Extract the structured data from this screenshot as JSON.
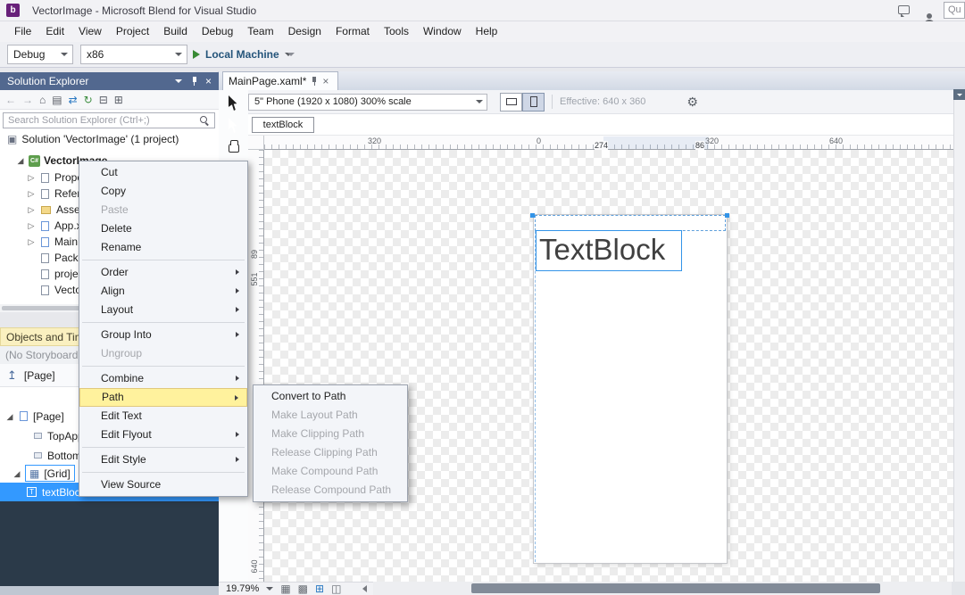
{
  "colors": {
    "accent": "#3399FF",
    "menu_highlight": "#FFF29D",
    "blend_purple": "#68217A",
    "run_green": "#388A34",
    "panel_header": "#52688F"
  },
  "titlebar": {
    "title": "VectorImage - Microsoft Blend for Visual Studio",
    "quick_launch": "Qu",
    "logo_letter": "b"
  },
  "menubar": {
    "items": [
      {
        "label": "File"
      },
      {
        "label": "Edit"
      },
      {
        "label": "View"
      },
      {
        "label": "Project"
      },
      {
        "label": "Build"
      },
      {
        "label": "Debug"
      },
      {
        "label": "Team"
      },
      {
        "label": "Design"
      },
      {
        "label": "Format"
      },
      {
        "label": "Tools"
      },
      {
        "label": "Window"
      },
      {
        "label": "Help"
      }
    ]
  },
  "toolbar": {
    "config": "Debug",
    "platform": "x86",
    "run_target": "Local Machine"
  },
  "icons": {
    "back": "←",
    "forward": "→",
    "home": "⌂",
    "scope": "▤",
    "sync": "⇄",
    "refresh": "↻",
    "collapse_all": "⊟",
    "show_all": "⊞",
    "expanded": "◢",
    "collapsed": "▷",
    "close": "×",
    "scope_up": "↥",
    "solution": "▣",
    "csharp": "C#",
    "grid_glyph": "▦",
    "textblock_t": "T",
    "zoom_grid": "▦",
    "snap_grid": "▩",
    "snap_lines": "⊞",
    "annotations": "◫",
    "gear": "⚙"
  },
  "solution_explorer": {
    "title": "Solution Explorer",
    "search_placeholder": "Search Solution Explorer (Ctrl+;)",
    "solution": "Solution 'VectorImage' (1 project)",
    "project": "VectorImage",
    "files": [
      {
        "label": "Properties"
      },
      {
        "label": "References"
      },
      {
        "label": "Assets"
      },
      {
        "label": "App.xaml"
      },
      {
        "label": "MainPage.xaml"
      },
      {
        "label": "Package.appxmanifest"
      },
      {
        "label": "project.json"
      },
      {
        "label": "VectorImage_TemporaryKey.pfx"
      }
    ]
  },
  "objects_panel": {
    "title": "Objects and Timeline",
    "storyboard_status": "(No Storyboard open)",
    "scope": "[Page]",
    "tree": [
      {
        "label": "[Page]"
      },
      {
        "label": "TopAppBar"
      },
      {
        "label": "BottomAppBar"
      },
      {
        "label": "[Grid]"
      },
      {
        "label": "textBlock"
      }
    ]
  },
  "context_menu": {
    "items": [
      {
        "label": "Cut"
      },
      {
        "label": "Copy"
      },
      {
        "label": "Paste",
        "disabled": true
      },
      {
        "label": "Delete"
      },
      {
        "label": "Rename"
      },
      {
        "label": "Order",
        "submenu": true
      },
      {
        "label": "Align",
        "submenu": true
      },
      {
        "label": "Layout",
        "submenu": true
      },
      {
        "label": "Group Into",
        "submenu": true
      },
      {
        "label": "Ungroup",
        "disabled": true
      },
      {
        "label": "Combine",
        "submenu": true
      },
      {
        "label": "Path",
        "submenu": true,
        "highlighted": true
      },
      {
        "label": "Edit Text"
      },
      {
        "label": "Edit Flyout",
        "submenu": true
      },
      {
        "label": "Edit Style",
        "submenu": true
      },
      {
        "label": "View Source"
      }
    ],
    "path_submenu": [
      {
        "label": "Convert to Path"
      },
      {
        "label": "Make Layout Path",
        "disabled": true
      },
      {
        "label": "Make Clipping Path",
        "disabled": true
      },
      {
        "label": "Release Clipping Path",
        "disabled": true
      },
      {
        "label": "Make Compound Path",
        "disabled": true
      },
      {
        "label": "Release Compound Path",
        "disabled": true
      }
    ]
  },
  "design_surface": {
    "tab": "MainPage.xaml*",
    "device": "5\" Phone (1920 x 1080) 300% scale",
    "effective": "Effective: 640 x 360",
    "breadcrumb": "textBlock",
    "zoom": "19.79%",
    "artboard_text": "TextBlock",
    "ruler_h": [
      "320",
      "0",
      "320",
      "640"
    ],
    "ruler_markers": [
      "274",
      "86"
    ],
    "ruler_v": [
      "89",
      "551",
      "640"
    ]
  }
}
